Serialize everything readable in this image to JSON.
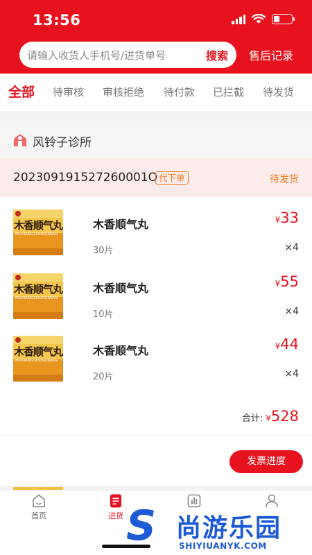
{
  "status_bar": {
    "time": "13:56",
    "signal_icon": "cellular-signal-icon",
    "wifi_icon": "wifi-icon",
    "battery_icon": "battery-icon"
  },
  "header": {
    "search_placeholder": "请输入收货人手机号/进货单号",
    "search_button": "搜索",
    "after_sale_link": "售后记录"
  },
  "tabs": [
    {
      "label": "全部",
      "active": true
    },
    {
      "label": "待审核",
      "active": false
    },
    {
      "label": "审核拒绝",
      "active": false
    },
    {
      "label": "待付款",
      "active": false
    },
    {
      "label": "已拦截",
      "active": false
    },
    {
      "label": "待发货",
      "active": false
    }
  ],
  "order": {
    "clinic_icon": "clinic-icon",
    "clinic_name": "风铃子诊所",
    "order_no": "202309191527260001O",
    "tag": "代下单",
    "status": "待发货",
    "items": [
      {
        "name": "木香顺气丸",
        "spec": "30片",
        "price_currency": "¥",
        "price": "33",
        "qty": "×4",
        "box_text": "木香顺气丸",
        "box_pinyin": "MUXIANGSHUNQIWAN"
      },
      {
        "name": "木香顺气丸",
        "spec": "10片",
        "price_currency": "¥",
        "price": "55",
        "qty": "×4",
        "box_text": "木香顺气丸",
        "box_pinyin": "MUXIANGSHUNQIWAN"
      },
      {
        "name": "木香顺气丸",
        "spec": "20片",
        "price_currency": "¥",
        "price": "44",
        "qty": "×4",
        "box_text": "木香顺气丸",
        "box_pinyin": "MUXIANGSHUNQIWAN"
      }
    ],
    "total_label": "合计:",
    "total_currency": "¥",
    "total": "528",
    "invoice_button": "发票进度"
  },
  "bottom_nav": [
    {
      "label": "首页",
      "icon": "home-icon",
      "active": false
    },
    {
      "label": "进货",
      "icon": "order-doc-icon",
      "active": true
    },
    {
      "label": "",
      "icon": "chart-icon",
      "active": false
    },
    {
      "label": "",
      "icon": "user-icon",
      "active": false
    }
  ],
  "watermark": {
    "mark": "S",
    "name": "尚游乐园",
    "domain": "SHIYIUANYK.COM"
  },
  "colors": {
    "brand_red": "#e8121e",
    "accent_orange": "#f07a1b",
    "watermark_blue": "#1d5bd6"
  }
}
